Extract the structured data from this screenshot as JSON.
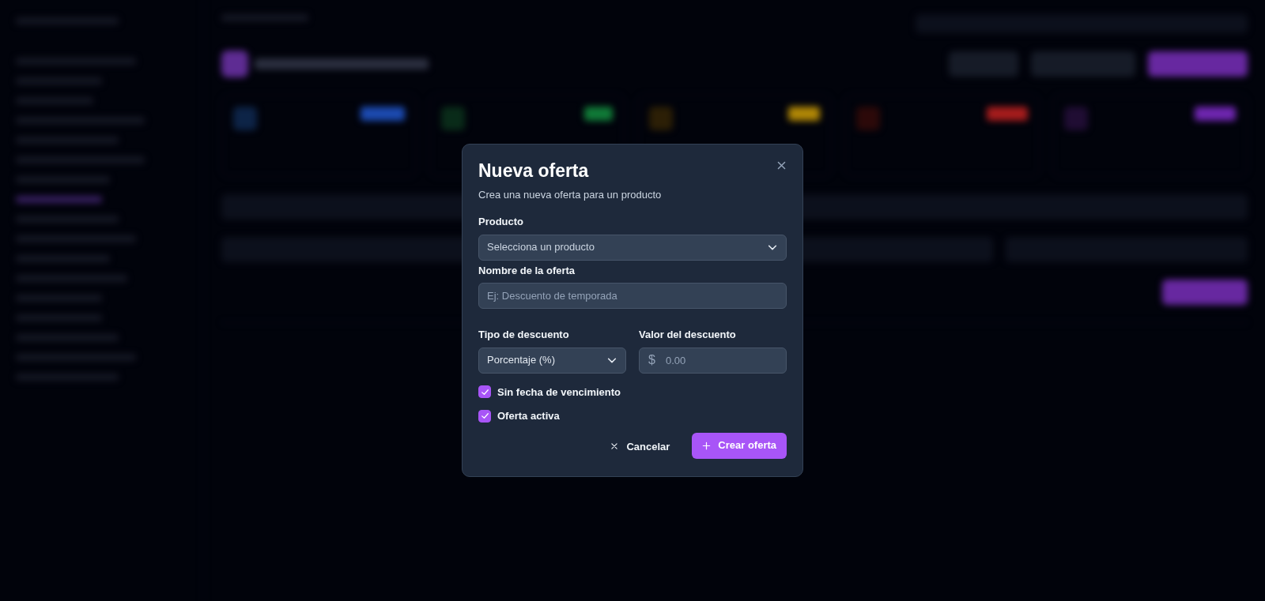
{
  "dialog": {
    "title": "Nueva oferta",
    "subtitle": "Crea una nueva oferta para un producto",
    "fields": [
      {
        "kind": "select",
        "label": "Producto",
        "placeholder": "Selecciona un producto"
      },
      {
        "kind": "text",
        "label": "Nombre de la oferta",
        "placeholder": "Ej: Descuento de temporada"
      }
    ],
    "discount_type": {
      "label": "Tipo de descuento",
      "value": "Porcentaje (%)"
    },
    "discount_value": {
      "label": "Valor del descuento",
      "prefix": "$",
      "placeholder": "0.00"
    },
    "checkboxes": [
      {
        "label": "Sin fecha de vencimiento",
        "checked": true
      },
      {
        "label": "Oferta activa",
        "checked": true
      }
    ],
    "buttons": [
      {
        "kind": "cancel",
        "label": "Cancelar"
      },
      {
        "kind": "create",
        "label": "Crear oferta"
      }
    ]
  }
}
